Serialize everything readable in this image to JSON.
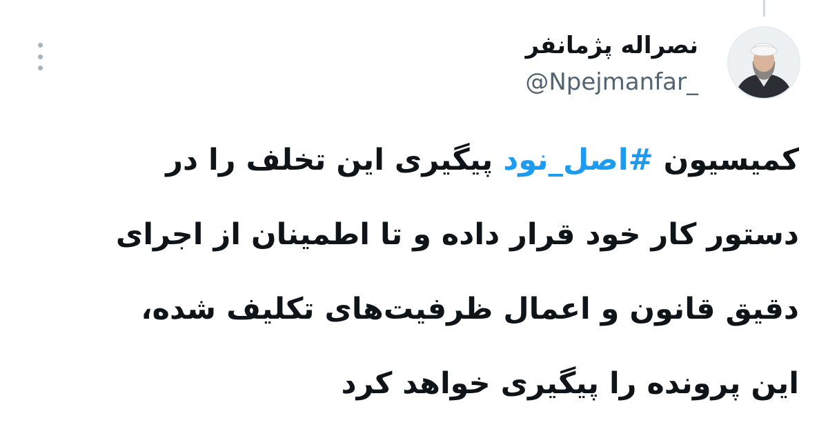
{
  "author": {
    "display_name": "نصراله پژمانفر",
    "handle": "@Npejmanfar_"
  },
  "tweet": {
    "line1_before": "کمیسیون ",
    "line1_hashtag": "#اصل_نود",
    "line1_after": " پیگیری این تخلف را در",
    "line2": "دستور کار خود قرار داده و تا اطمینان از اجرای",
    "line3": "دقیق قانون و اعمال ظرفیت‌های تکلیف شده،",
    "line4": "این پرونده را پیگیری خواهد کرد"
  },
  "icons": {
    "more": "more-vertical-icon",
    "avatar": "profile-photo"
  },
  "colors": {
    "hashtag": "#1d9bf0",
    "handle": "#536471",
    "text": "#0f1419",
    "thread_line": "#cfd9de"
  }
}
